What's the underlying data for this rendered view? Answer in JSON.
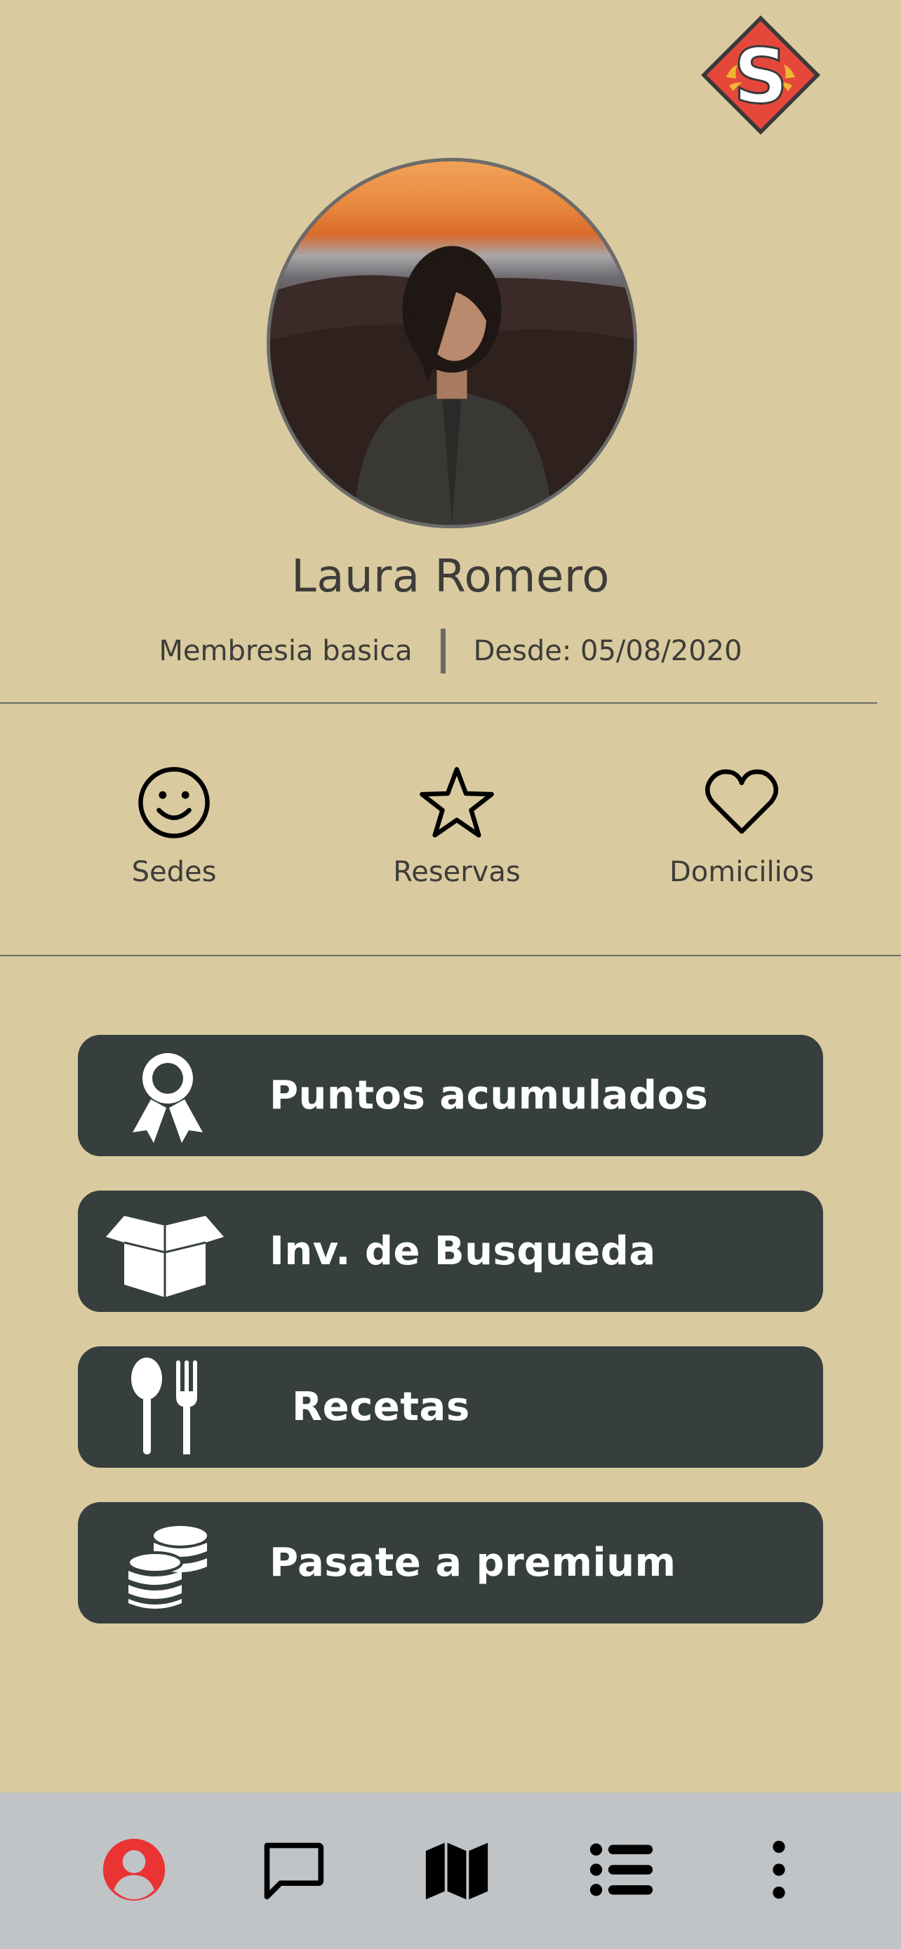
{
  "colors": {
    "background": "#d9cb9f",
    "button_bg": "#363e3e",
    "button_text": "#ffffff",
    "text": "#3d3c39",
    "nav_bg": "#c0c4c7",
    "nav_active": "#ea3333",
    "logo_red": "#e5483b"
  },
  "logo": {
    "letter": "S",
    "icon": "brand-logo-icon"
  },
  "profile": {
    "name": "Laura Romero",
    "membership": "Membresia basica",
    "since": "Desde: 05/08/2020",
    "avatar_icon": "profile-photo"
  },
  "quick_actions": [
    {
      "label": "Sedes",
      "icon": "smiley-icon"
    },
    {
      "label": "Reservas",
      "icon": "star-icon"
    },
    {
      "label": "Domicilios",
      "icon": "heart-icon"
    }
  ],
  "menu": [
    {
      "label": "Puntos acumulados",
      "icon": "award-ribbon-icon"
    },
    {
      "label": "Inv. de Busqueda",
      "icon": "open-box-icon"
    },
    {
      "label": "Recetas",
      "icon": "spoon-fork-icon"
    },
    {
      "label": "Pasate a premium",
      "icon": "coins-icon"
    }
  ],
  "bottom_nav": [
    {
      "icon": "profile-icon",
      "active": true
    },
    {
      "icon": "chat-icon",
      "active": false
    },
    {
      "icon": "map-icon",
      "active": false
    },
    {
      "icon": "list-icon",
      "active": false
    },
    {
      "icon": "more-vertical-icon",
      "active": false
    }
  ]
}
